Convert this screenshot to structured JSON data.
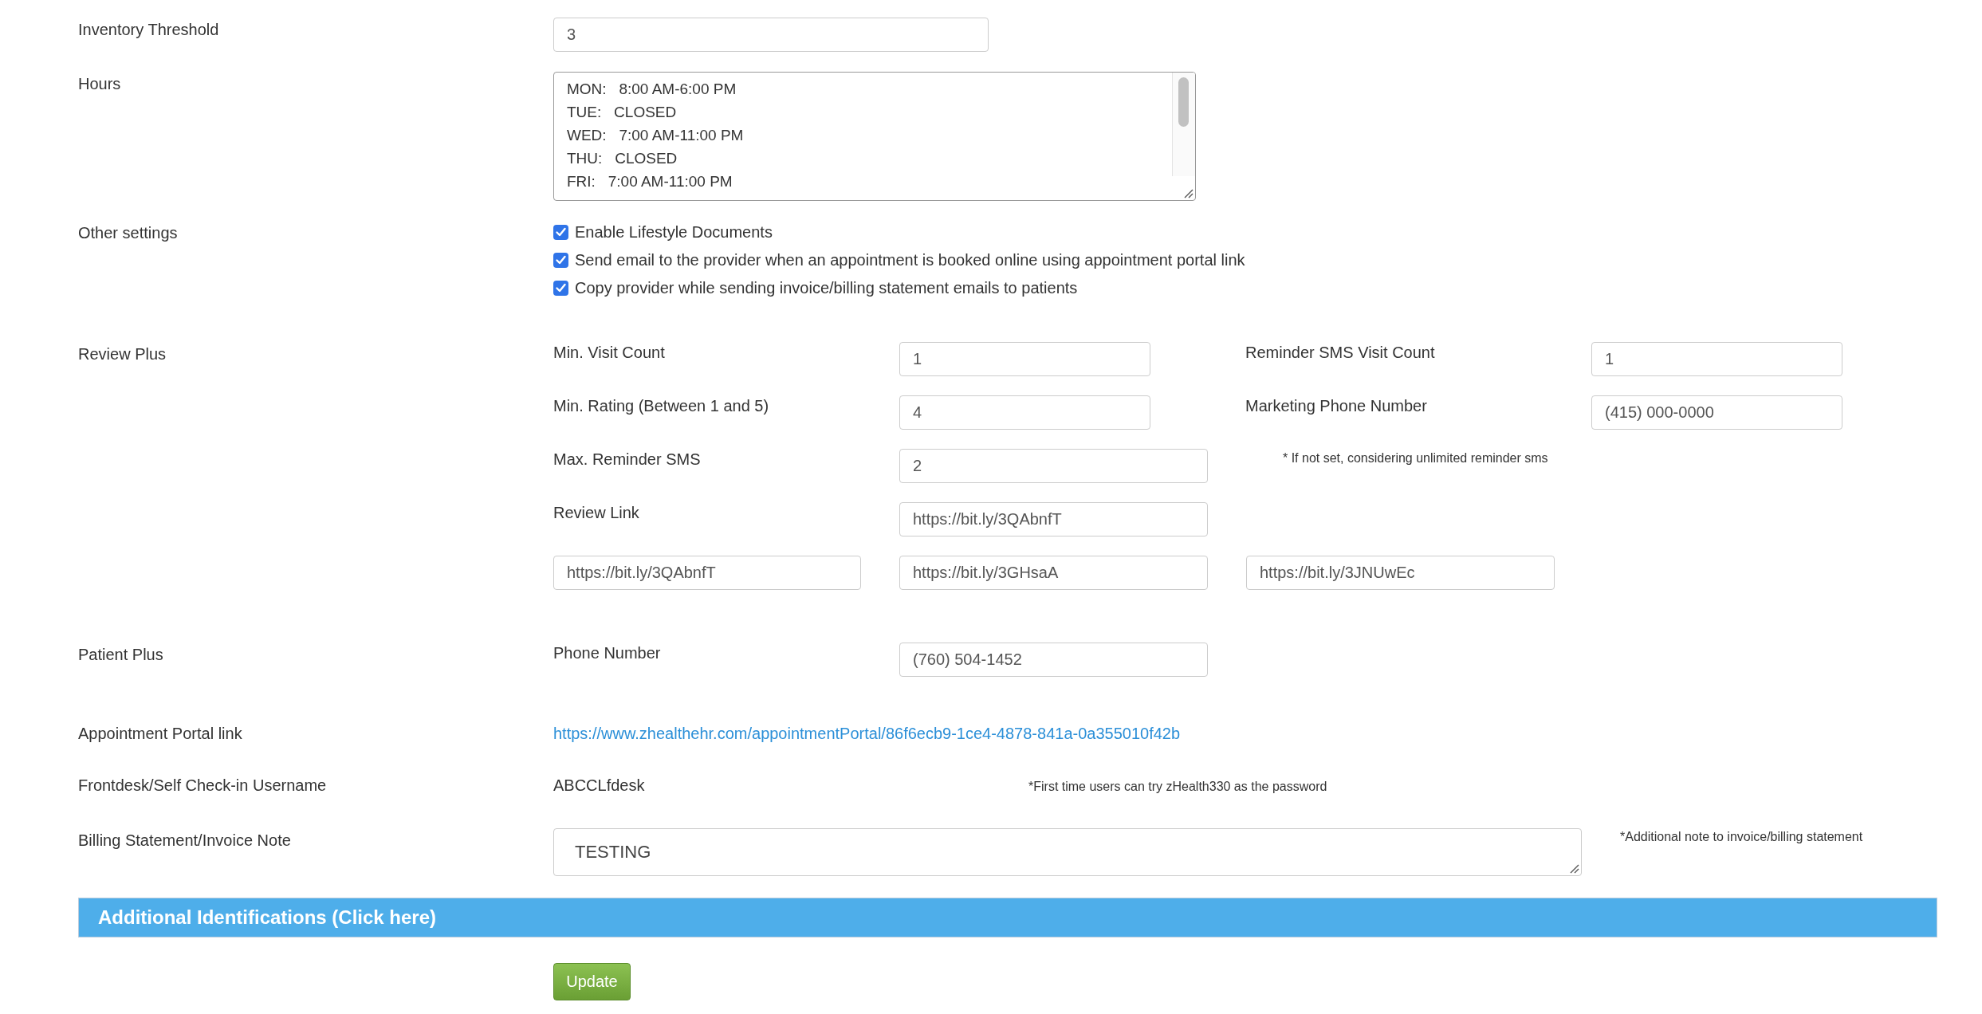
{
  "inventory_threshold": {
    "label": "Inventory Threshold",
    "value": "3"
  },
  "hours": {
    "label": "Hours",
    "lines": [
      "MON:   8:00 AM-6:00 PM",
      "TUE:   CLOSED",
      "WED:   7:00 AM-11:00 PM",
      "THU:   CLOSED",
      "FRI:   7:00 AM-11:00 PM"
    ]
  },
  "other_settings": {
    "label": "Other settings",
    "options": [
      {
        "label": "Enable Lifestyle Documents",
        "checked": true
      },
      {
        "label": "Send email to the provider when an appointment is booked online using appointment portal link",
        "checked": true
      },
      {
        "label": "Copy provider while sending invoice/billing statement emails to patients",
        "checked": true
      }
    ]
  },
  "review_plus": {
    "label": "Review Plus",
    "min_visit_count": {
      "label": "Min. Visit Count",
      "value": "1"
    },
    "reminder_sms_visit_count": {
      "label": "Reminder SMS Visit Count",
      "value": "1"
    },
    "min_rating": {
      "label": "Min. Rating (Between 1 and 5)",
      "value": "4"
    },
    "marketing_phone_number": {
      "label": "Marketing Phone Number",
      "value": "(415) 000-0000"
    },
    "max_reminder_sms": {
      "label": "Max. Reminder SMS",
      "value": "2",
      "note": "* If not set, considering unlimited reminder sms"
    },
    "review_link": {
      "label": "Review Link",
      "value": "https://bit.ly/3QAbnfT"
    },
    "links": [
      "https://bit.ly/3QAbnfT",
      "https://bit.ly/3GHsaA",
      "https://bit.ly/3JNUwEc"
    ]
  },
  "patient_plus": {
    "label": "Patient Plus",
    "phone_label": "Phone Number",
    "phone_value": "(760) 504-1452"
  },
  "appointment_portal": {
    "label": "Appointment Portal link",
    "link": "https://www.zhealthehr.com/appointmentPortal/86f6ecb9-1ce4-4878-841a-0a355010f42b"
  },
  "frontdesk": {
    "label": "Frontdesk/Self Check-in Username",
    "value": "ABCCLfdesk",
    "note": "*First time users can try zHealth330 as the password"
  },
  "billing_note": {
    "label": "Billing Statement/Invoice Note",
    "value": "TESTING",
    "note": "*Additional note to invoice/billing statement"
  },
  "additional_identifications": {
    "title": "Additional Identifications (Click here)"
  },
  "update_button": "Update"
}
